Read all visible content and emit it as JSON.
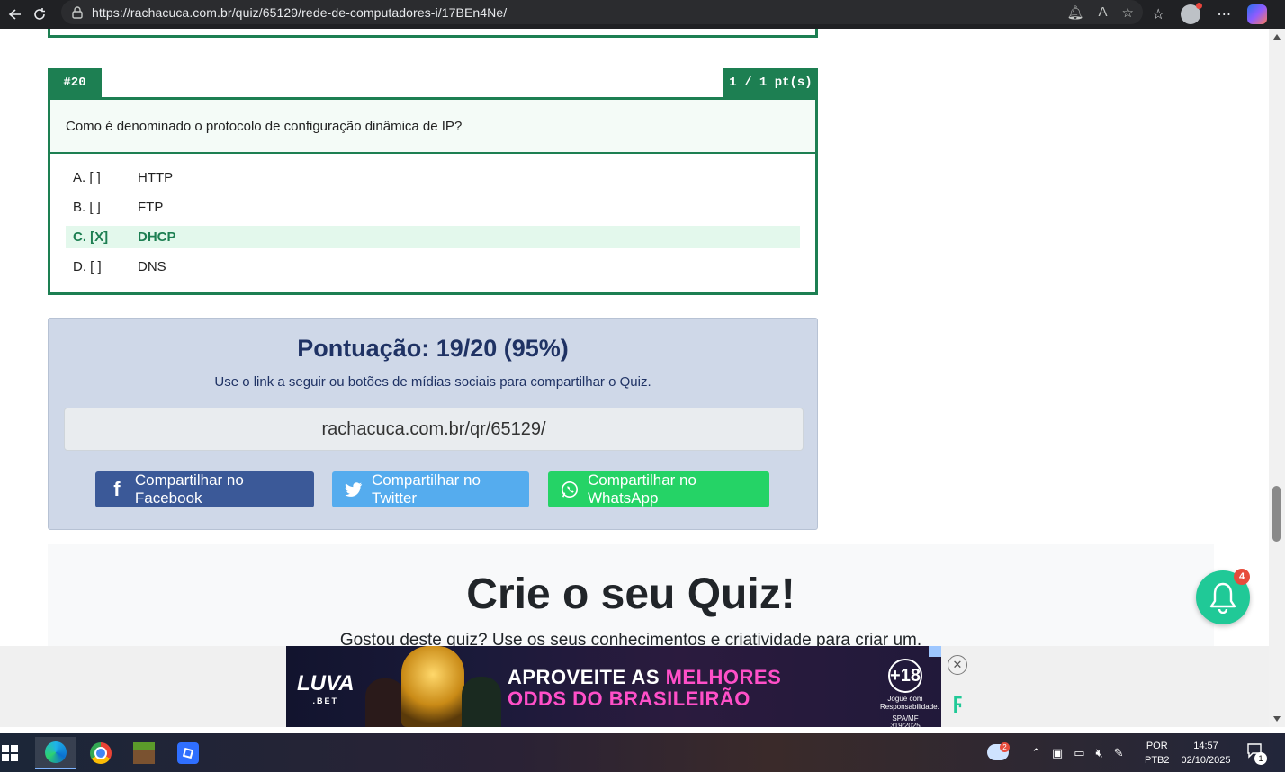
{
  "browser": {
    "url": "https://rachacuca.com.br/quiz/65129/rede-de-computadores-i/17BEn4Ne/"
  },
  "question": {
    "number": "#20",
    "points": "1 / 1 pt(s)",
    "text": "Como é denominado o protocolo de configuração dinâmica de IP?",
    "answers": [
      {
        "letter": "A. [  ]",
        "text": "HTTP",
        "selected": false
      },
      {
        "letter": "B. [  ]",
        "text": "FTP",
        "selected": false
      },
      {
        "letter": "C. [X]",
        "text": "DHCP",
        "selected": true
      },
      {
        "letter": "D. [  ]",
        "text": "DNS",
        "selected": false
      }
    ]
  },
  "score": {
    "title": "Pontuação: 19/20 (95%)",
    "subtitle": "Use o link a seguir ou botões de mídias sociais para compartilhar o Quiz.",
    "share_link": "rachacuca.com.br/qr/65129/",
    "buttons": {
      "facebook": "Compartilhar no Facebook",
      "twitter": "Compartilhar no Twitter",
      "whatsapp": "Compartilhar no WhatsApp"
    }
  },
  "create": {
    "title": "Crie o seu Quiz!",
    "subtitle": "Gostou deste quiz? Use os seus conhecimentos e criatividade para criar um."
  },
  "notification": {
    "badge": "4"
  },
  "ad": {
    "logo": "LUVA",
    "logo_sub": ".BET",
    "line1_a": "APROVEITE AS ",
    "line1_b": "MELHORES",
    "line2": "ODDS DO BRASILEIRÃO",
    "age": "+18",
    "age_note": "Jogue com Responsabilidade.",
    "age_reg": "SPA/MF 319/2025"
  },
  "taskbar": {
    "weather_badge": "2",
    "lang1": "POR",
    "lang2": "PTB2",
    "time": "14:57",
    "date": "02/10/2025",
    "notif_count": "1"
  },
  "colors": {
    "quiz_green": "#1d7f52",
    "score_bg": "#cfd8e8",
    "facebook": "#3b5998",
    "twitter": "#55acee",
    "whatsapp": "#25d366",
    "bell": "#20c997"
  }
}
